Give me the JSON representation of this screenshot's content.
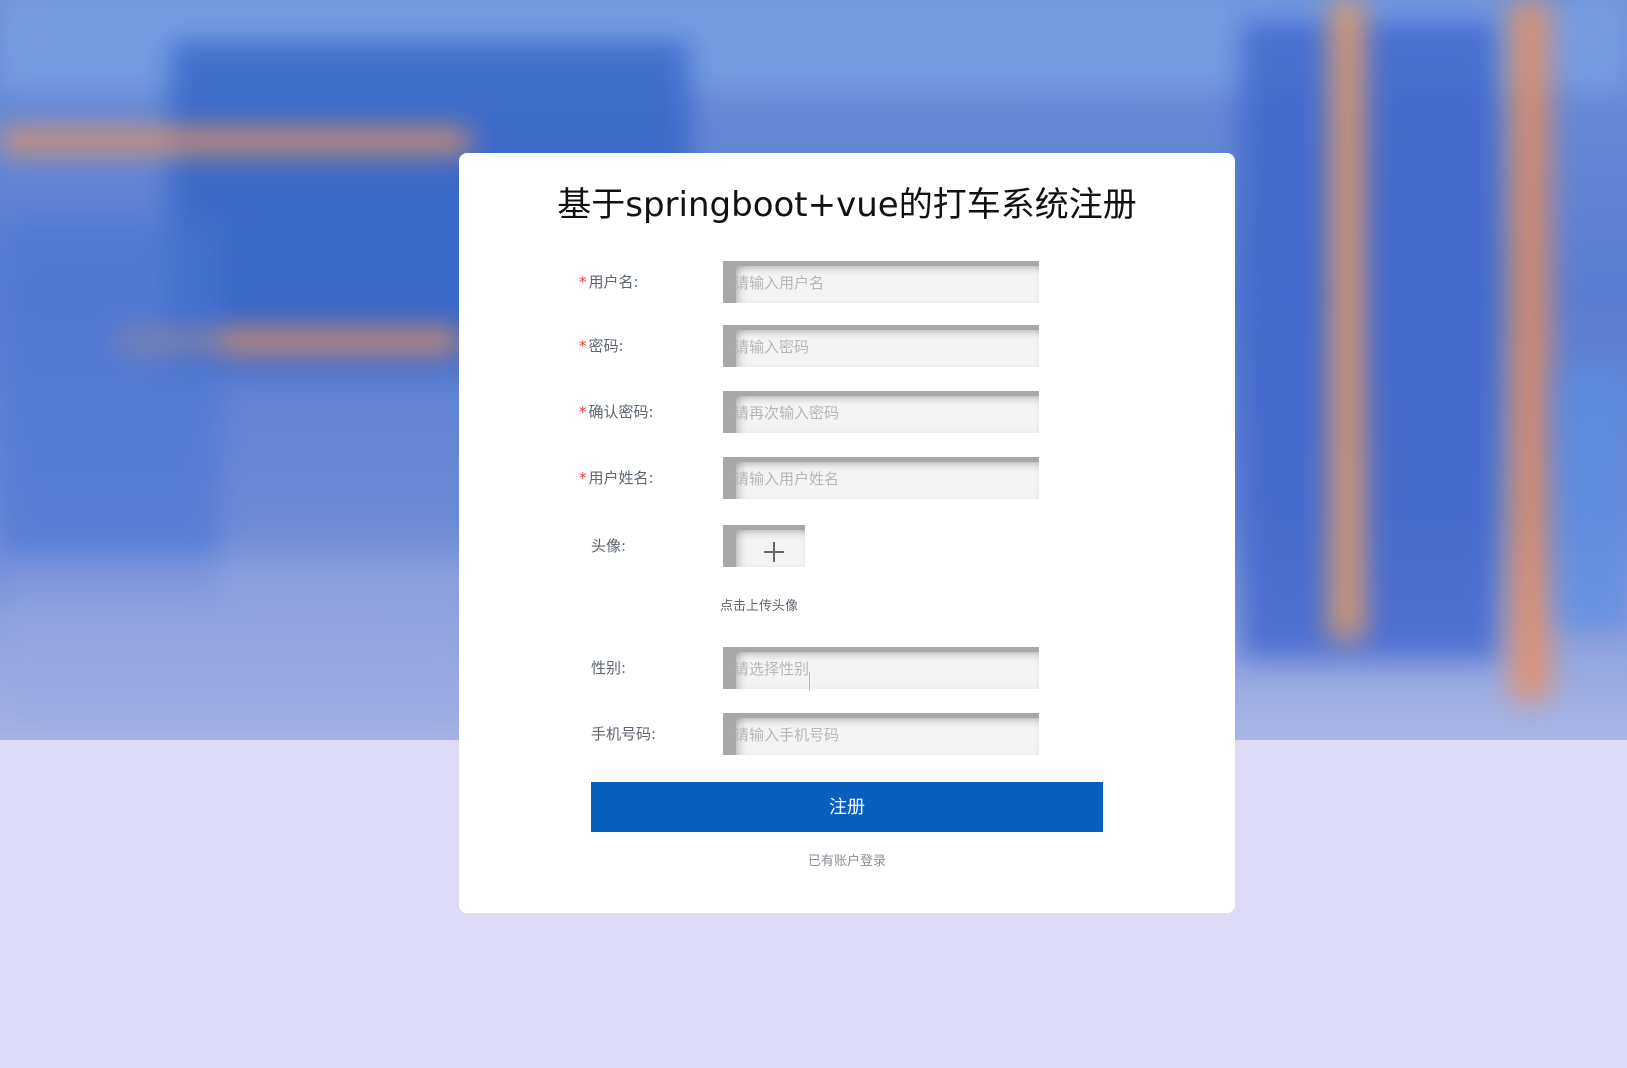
{
  "page": {
    "title": "基于springboot+vue的打车系统注册"
  },
  "form": {
    "fields": [
      {
        "label": "用户名:",
        "required": true,
        "placeholder": "请输入用户名"
      },
      {
        "label": "密码:",
        "required": true,
        "placeholder": "请输入密码"
      },
      {
        "label": "确认密码:",
        "required": true,
        "placeholder": "请再次输入密码"
      },
      {
        "label": "用户姓名:",
        "required": true,
        "placeholder": "请输入用户姓名"
      }
    ],
    "avatar": {
      "label": "头像:",
      "hint": "点击上传头像",
      "icon": "plus-icon"
    },
    "gender": {
      "label": "性别:",
      "placeholder": "请选择性别",
      "icon": "chevron-down-icon"
    },
    "phone": {
      "label": "手机号码:",
      "placeholder": "请输入手机号码"
    },
    "required_mark": "*",
    "submit_label": "注册",
    "login_link": "已有账户登录"
  },
  "colors": {
    "primary": "#0760bd",
    "required": "#e03a3a",
    "page_bg": "#dedbf6"
  }
}
